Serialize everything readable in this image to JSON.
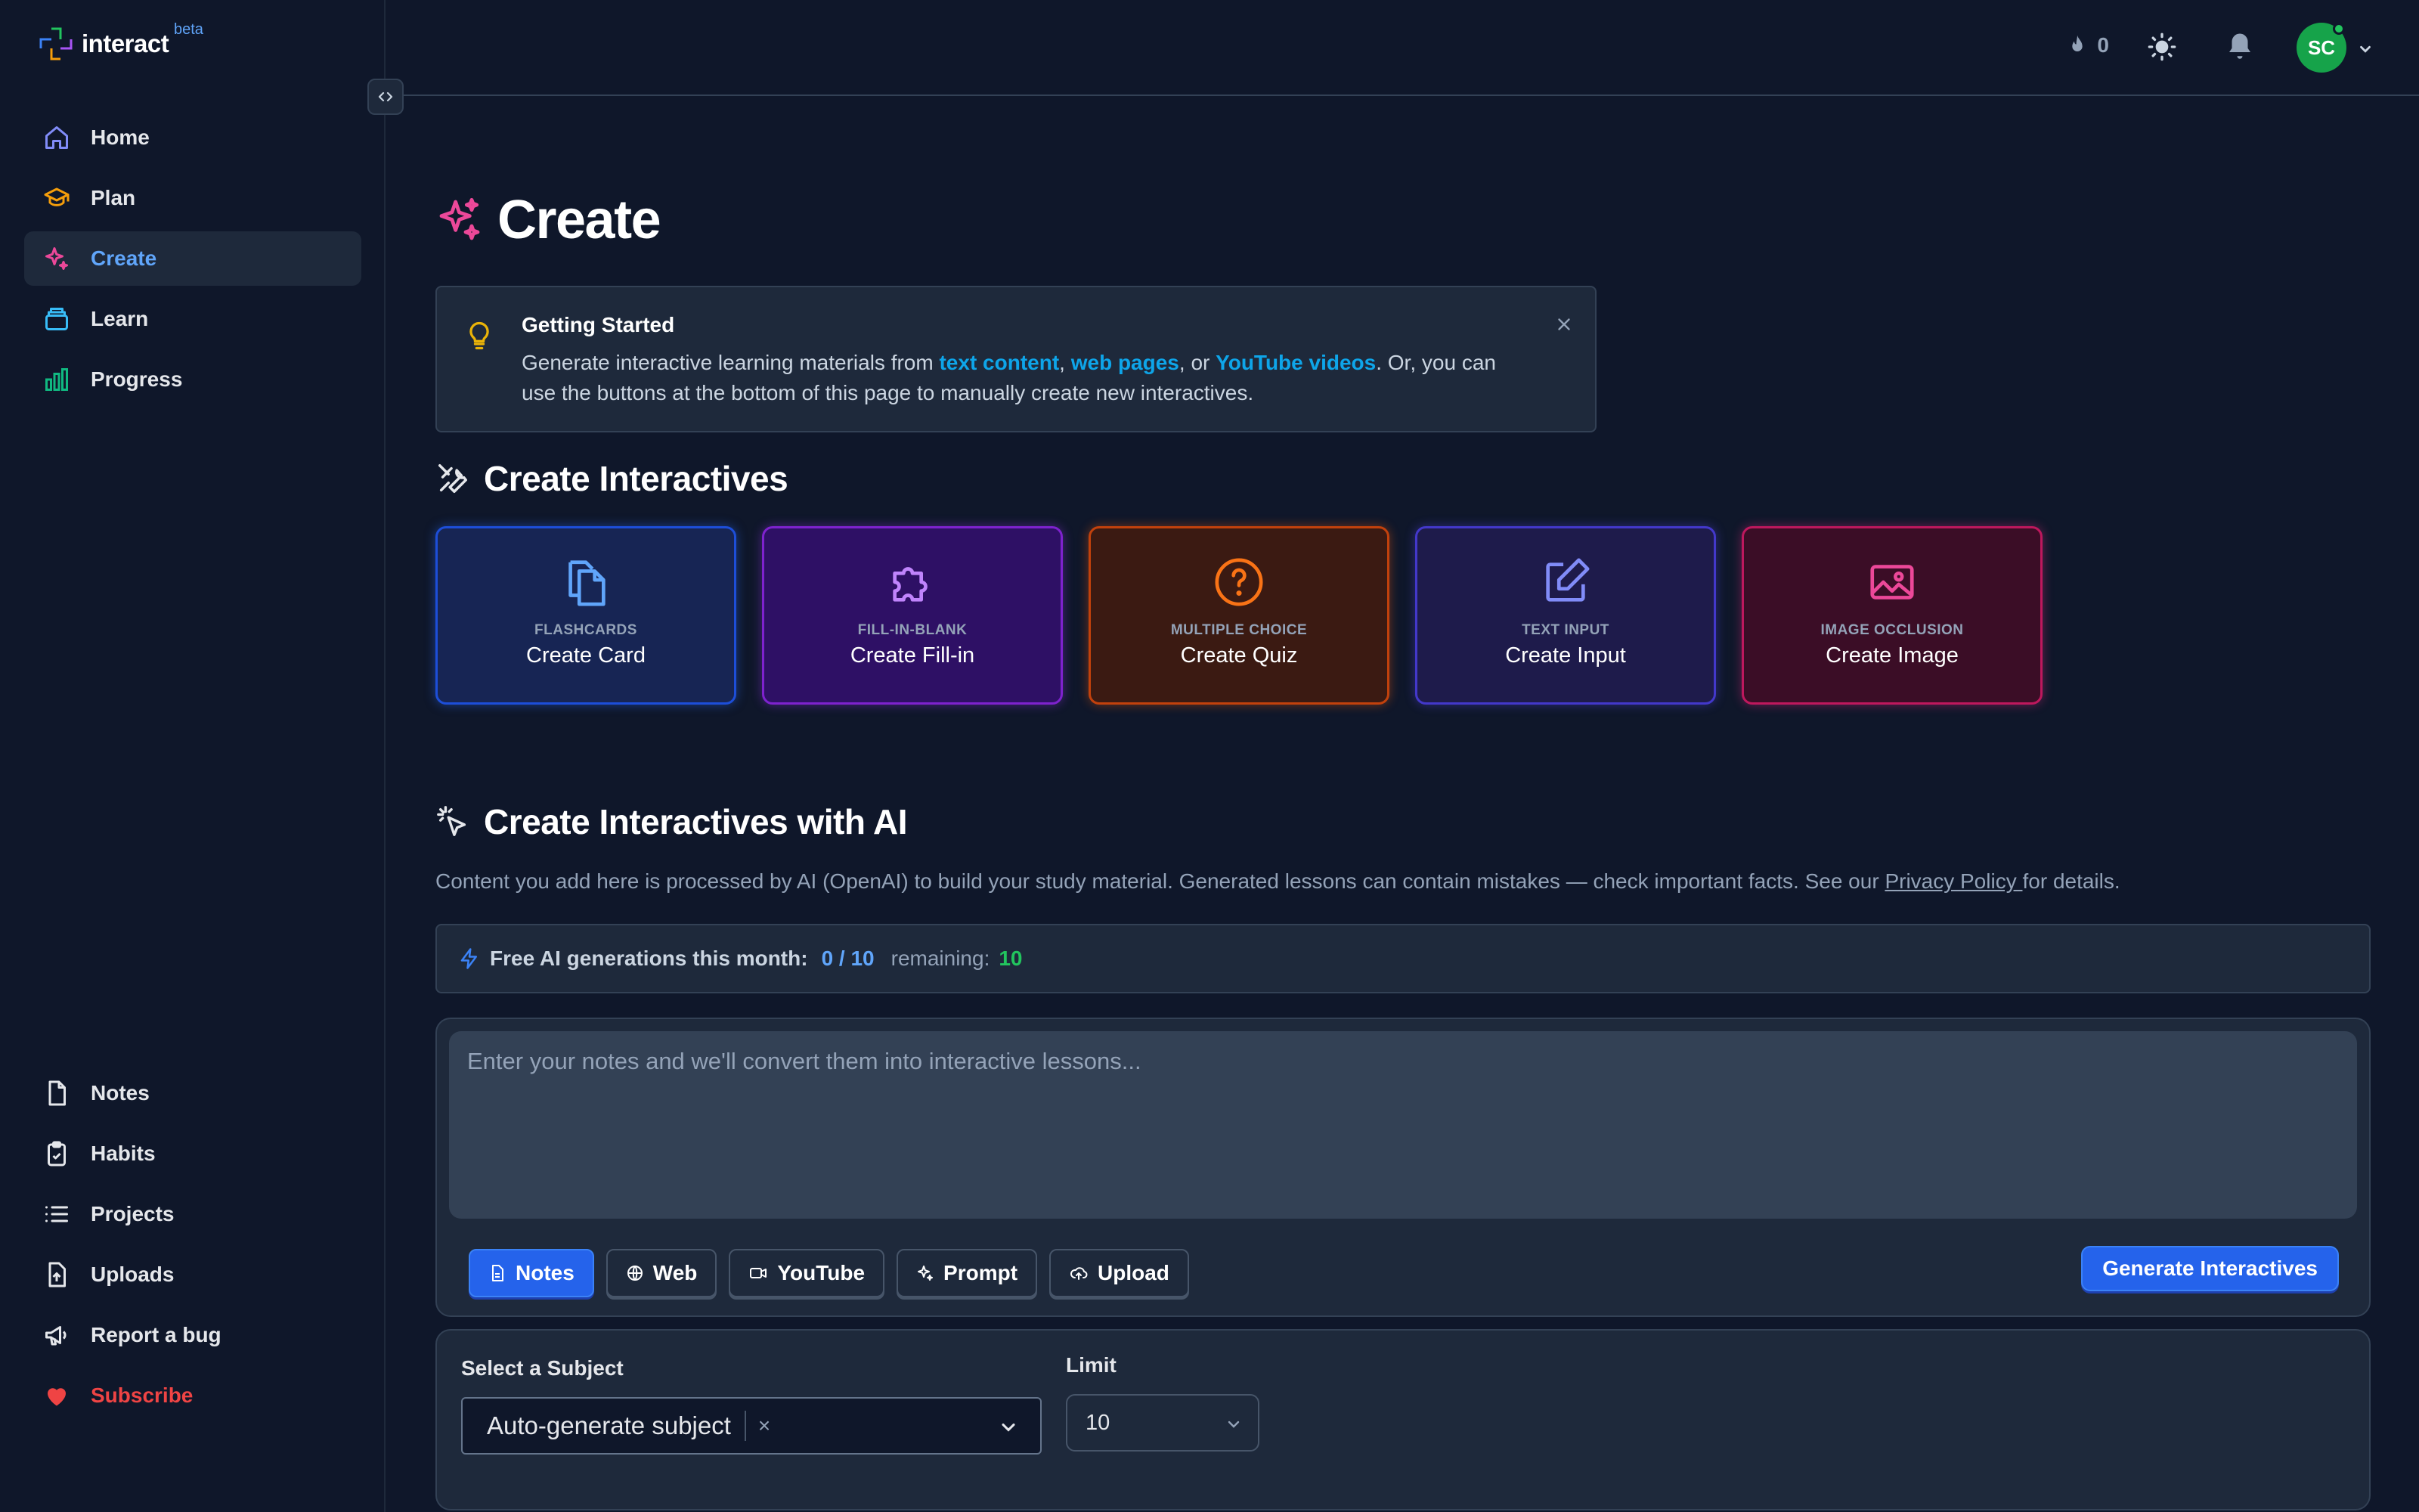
{
  "app": {
    "logo_text": "interact",
    "logo_badge": "beta"
  },
  "sidebar": {
    "top_items": [
      {
        "label": "Home",
        "icon": "home-icon"
      },
      {
        "label": "Plan",
        "icon": "graduation-cap-icon"
      },
      {
        "label": "Create",
        "icon": "sparkles-icon",
        "active": true
      },
      {
        "label": "Learn",
        "icon": "layers-icon"
      },
      {
        "label": "Progress",
        "icon": "bar-chart-icon"
      }
    ],
    "bottom_items": [
      {
        "label": "Notes",
        "icon": "file-icon"
      },
      {
        "label": "Habits",
        "icon": "clipboard-check-icon"
      },
      {
        "label": "Projects",
        "icon": "list-icon"
      },
      {
        "label": "Uploads",
        "icon": "file-upload-icon"
      },
      {
        "label": "Report a bug",
        "icon": "megaphone-icon"
      },
      {
        "label": "Subscribe",
        "icon": "heart-icon"
      }
    ]
  },
  "header": {
    "streak_count": "0",
    "avatar_initials": "SC"
  },
  "page": {
    "title": "Create"
  },
  "tip": {
    "title": "Getting Started",
    "text_1": "Generate interactive learning materials from ",
    "link_text": "text content",
    "text_2": ", ",
    "link_web": "web pages",
    "text_3": ", or ",
    "link_youtube": "YouTube videos",
    "text_4": ". Or, you can use the buttons at the bottom of this page to manually create new interactives."
  },
  "create_section": {
    "title": "Create Interactives",
    "cards": [
      {
        "caption": "FLASHCARDS",
        "label": "Create Card",
        "icon": "copy-icon"
      },
      {
        "caption": "FILL-IN-BLANK",
        "label": "Create Fill-in",
        "icon": "puzzle-icon"
      },
      {
        "caption": "MULTIPLE CHOICE",
        "label": "Create Quiz",
        "icon": "help-circle-icon"
      },
      {
        "caption": "TEXT INPUT",
        "label": "Create Input",
        "icon": "pencil-square-icon"
      },
      {
        "caption": "IMAGE OCCLUSION",
        "label": "Create Image",
        "icon": "image-icon"
      }
    ]
  },
  "ai_section": {
    "title": "Create Interactives with AI",
    "description": "Content you add here is processed by AI (OpenAI) to build your study material. Generated lessons can contain mistakes — check important facts. See our ",
    "privacy_link": "Privacy Policy ",
    "description_end": "for details.",
    "usage_label": "Free AI generations this month:",
    "usage_count": "0 / 10",
    "remaining_label": "remaining:",
    "remaining_value": "10",
    "input_placeholder": "Enter your notes and we'll convert them into interactive lessons...",
    "source_tabs": [
      {
        "label": "Notes",
        "icon": "file-text-icon",
        "active": true
      },
      {
        "label": "Web",
        "icon": "globe-icon"
      },
      {
        "label": "YouTube",
        "icon": "video-icon"
      },
      {
        "label": "Prompt",
        "icon": "sparkles-icon"
      },
      {
        "label": "Upload",
        "icon": "cloud-upload-icon"
      }
    ],
    "generate_button": "Generate Interactives"
  },
  "settings": {
    "subject_label": "Select a Subject",
    "subject_value": "Auto-generate subject",
    "subject_clear": "×",
    "limit_label": "Limit",
    "limit_value": "10"
  },
  "colors": {
    "background": "#0f172a",
    "panel": "#1e293b",
    "accent_blue": "#2563eb",
    "link_cyan": "#0ea5e9",
    "success_green": "#22c55e",
    "danger_red": "#ef4444"
  }
}
